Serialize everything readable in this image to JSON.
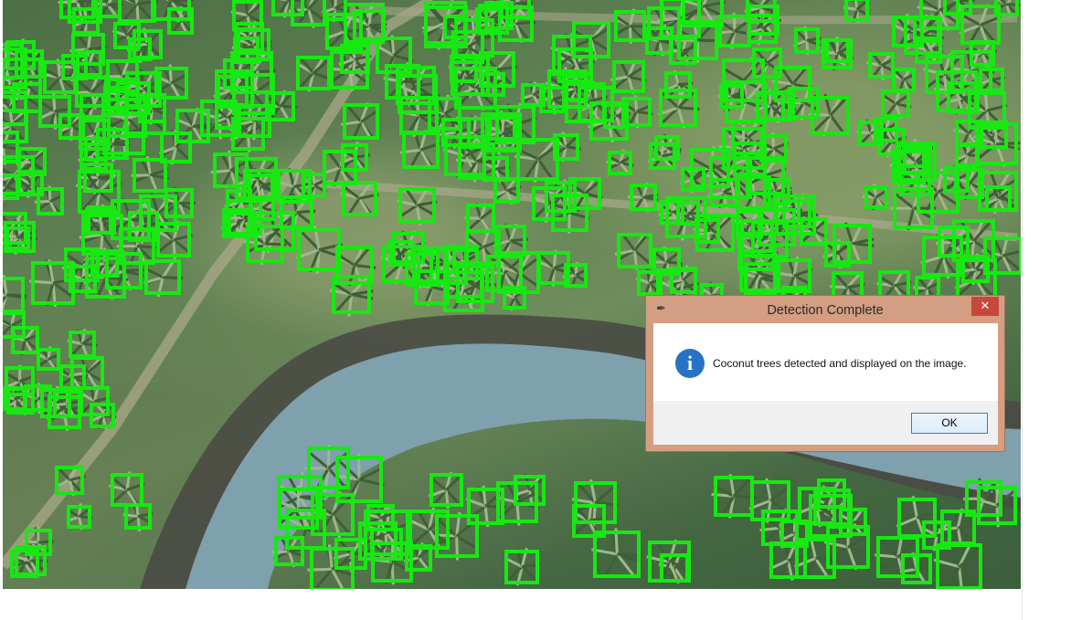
{
  "image": {
    "description_label": "",
    "detection_box_color": "#17e812"
  },
  "dialog": {
    "title": "Detection Complete",
    "title_icon": "feather-icon",
    "close_label": "✕",
    "message_icon": "info-icon",
    "info_glyph": "i",
    "message": "Coconut trees detected and displayed on the image.",
    "ok_label": "OK"
  },
  "colors": {
    "dialog_frame": "#d49e82",
    "close_button": "#c7473b",
    "info_icon": "#2872c6",
    "ok_border": "#3c7fb1"
  }
}
